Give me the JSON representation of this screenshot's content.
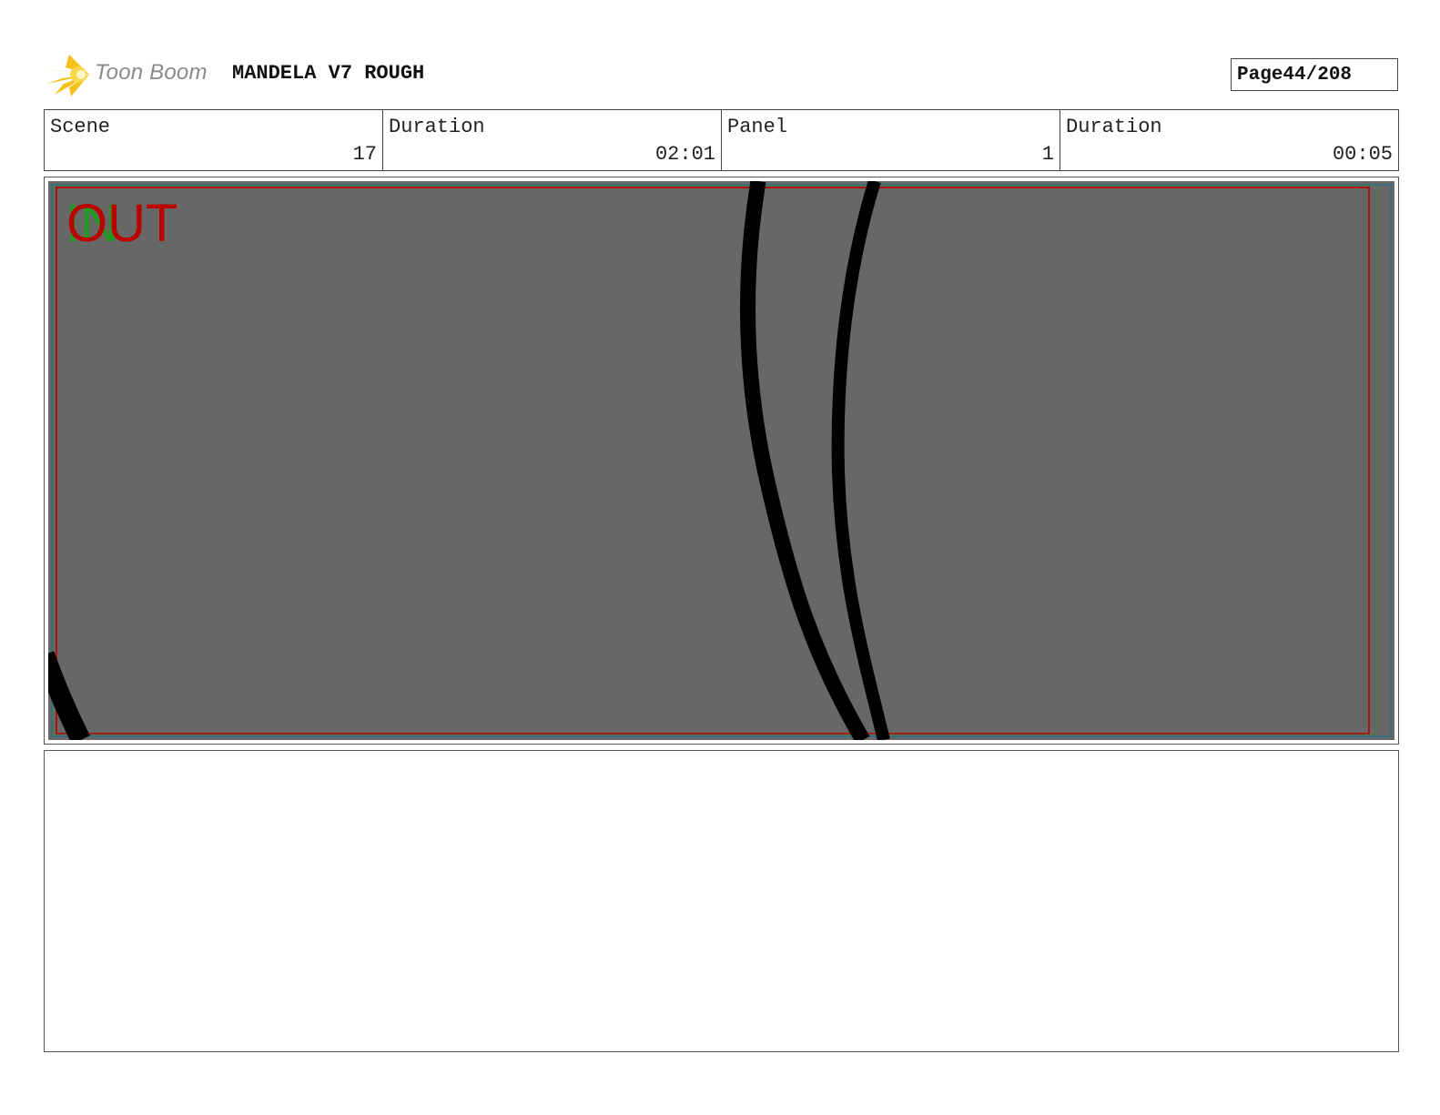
{
  "header": {
    "logo_text": "Toon Boom",
    "project_title": "MANDELA V7 ROUGH",
    "page_label": "Page",
    "page_number": "44/208"
  },
  "info": {
    "scene_label": "Scene",
    "scene_value": "17",
    "scene_duration_label": "Duration",
    "scene_duration_value": "02:01",
    "panel_label": "Panel",
    "panel_value": "1",
    "panel_duration_label": "Duration",
    "panel_duration_value": "00:05"
  },
  "panel": {
    "in_marker": "IN",
    "out_marker": "OUT",
    "background_color": "#676767",
    "out_color": "#bb0000",
    "in_color": "#19a019"
  },
  "notes": {
    "text": ""
  }
}
